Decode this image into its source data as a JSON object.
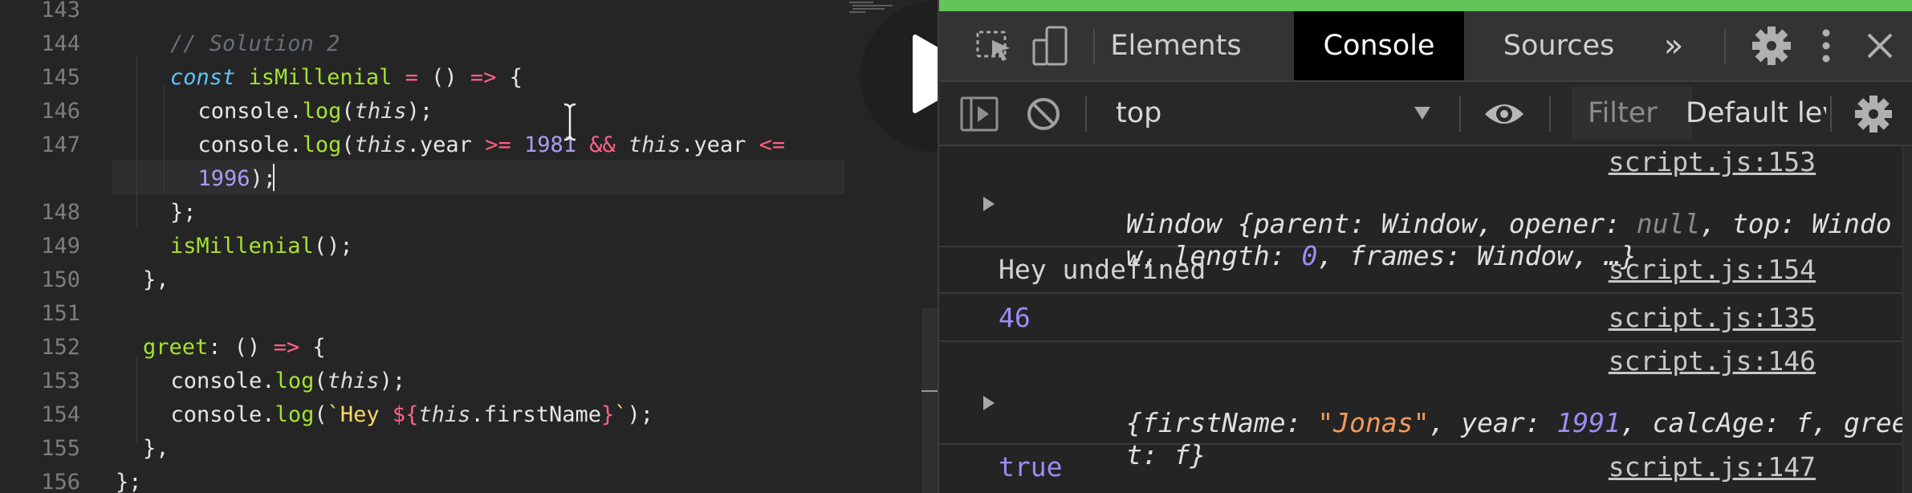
{
  "editor": {
    "lines": [
      {
        "num": "143",
        "html": ""
      },
      {
        "num": "144",
        "html": "<span class='cmt'>// Solution 2</span>"
      },
      {
        "num": "145",
        "html": "<span class='kw'>const</span> <span class='fn'>isMillenial</span> <span class='pk'>=</span> () <span class='pk'>=&gt;</span> {"
      },
      {
        "num": "146",
        "html": "  console.<span class='fn'>log</span>(<span class='th'>this</span>);"
      },
      {
        "num": "147",
        "html": "  console.<span class='fn'>log</span>(<span class='th'>this</span>.year <span class='pk'>&gt;=</span> <span class='nm'>1981</span> <span class='pk'>&amp;&amp;</span> <span class='th'>this</span>.year <span class='pk'>&lt;=</span>"
      },
      {
        "num": "",
        "html": "  <span class='nm'>1996</span>);"
      },
      {
        "num": "148",
        "html": "};"
      },
      {
        "num": "149",
        "html": "<span class='fn'>isMillenial</span>();"
      },
      {
        "num": "150",
        "html": "},"
      },
      {
        "num": "151",
        "html": ""
      },
      {
        "num": "152",
        "html": "<span class='fn'>greet</span>: () <span class='pk'>=&gt;</span> {"
      },
      {
        "num": "153",
        "html": "  console.<span class='fn'>log</span>(<span class='th'>this</span>);"
      },
      {
        "num": "154",
        "html": "  console.<span class='fn'>log</span>(<span class='st'>`Hey </span><span class='pk'>${</span><span class='th'>this</span>.firstName<span class='pk'>}</span><span class='st'>`</span>);"
      },
      {
        "num": "155",
        "html": "},"
      },
      {
        "num": "156",
        "html": "};"
      }
    ],
    "line_plain": [
      "",
      "// Solution 2",
      "const isMillenial = () => {",
      "console.log(this);",
      "console.log(this.year >= 1981 && this.year <=",
      "1996);",
      "};",
      "isMillenial();",
      "},",
      "",
      "greet: () => {",
      "console.log(this);",
      "console.log(`Hey ${this.firstName}`);",
      "},",
      "};"
    ]
  },
  "devtools": {
    "tabs": {
      "elements": "Elements",
      "console": "Console",
      "sources": "Sources",
      "more": "»"
    },
    "toolbar": {
      "context": "top",
      "filter_placeholder": "Filter",
      "levels": "Default levels"
    },
    "messages": [
      {
        "source": "script.js:153",
        "text": "Window {parent: Window, opener: null, top: Window, length: 0, frames: Window, …}",
        "line1": "Window {parent: Window, opener: null, top: Windo",
        "line2": "w, length: 0, frames: Window, …}"
      },
      {
        "source": "script.js:154",
        "text": "Hey undefined"
      },
      {
        "source": "script.js:135",
        "text": "46"
      },
      {
        "source": "script.js:146",
        "text": "{firstName: \"Jonas\", year: 1991, calcAge: f, greet: f}",
        "line1": "{firstName: \"Jonas\", year: 1991, calcAge: f, gree",
        "line2": "t: f}"
      },
      {
        "source": "script.js:147",
        "text": "true"
      }
    ]
  },
  "icons": [
    "inspect-icon",
    "device-toggle-icon",
    "gear-icon",
    "kebab-menu-icon",
    "close-icon",
    "sidebar-toggle-icon",
    "clear-console-icon",
    "eye-icon",
    "play-icon",
    "text-cursor-icon"
  ],
  "colors": {
    "devtools_green_bar": "#61c558",
    "console_number": "#9d8cf6",
    "console_string": "#f39a5b"
  }
}
